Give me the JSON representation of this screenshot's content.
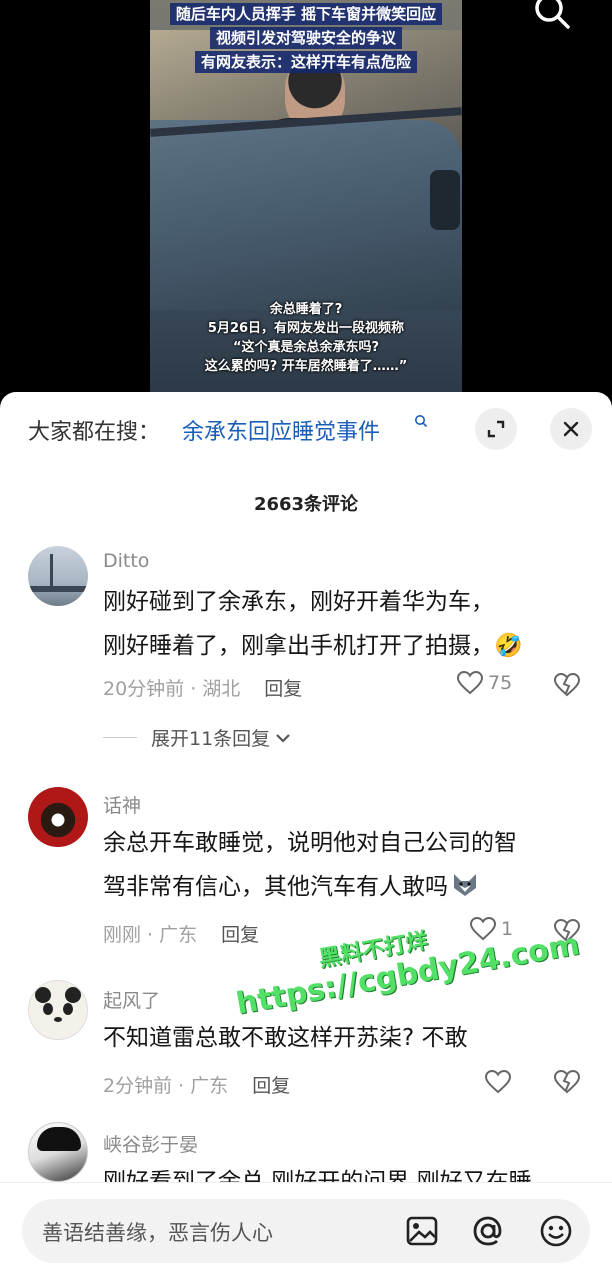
{
  "video": {
    "captions_top": [
      "随后车内人员挥手 摇下车窗并微笑回应",
      "视频引发对驾驶安全的争议",
      "有网友表示：这样开车有点危险"
    ],
    "captions_bottom": [
      "余总睡着了?",
      "5月26日，有网友发出一段视频称",
      "“这个真是余总余承东吗?",
      "这么累的吗? 开车居然睡着了……”"
    ]
  },
  "sheet": {
    "hot_prefix": "大家都在搜：",
    "hot_link": "余承东回应睡觉事件",
    "comment_count": "2663条评论"
  },
  "comments": [
    {
      "user": "Ditto",
      "text": [
        "刚好碰到了余承东，刚好开着华为车，",
        "刚好睡着了，刚拿出手机打开了拍摄，"
      ],
      "emoji": "🤣",
      "time": "20分钟前 · 湖北",
      "reply": "回复",
      "likes": "75",
      "expand": "展开11条回复"
    },
    {
      "user": "话神",
      "text": [
        "余总开车敢睡觉，说明他对自己公司的智",
        "驾非常有信心，其他汽车有人敢吗"
      ],
      "time": "刚刚 · 广东",
      "reply": "回复",
      "likes": "1"
    },
    {
      "user": "起风了",
      "text": [
        "不知道雷总敢不敢这样开苏柒? 不敢"
      ],
      "time": "2分钟前 · 广东",
      "reply": "回复",
      "likes": ""
    },
    {
      "user": "峡谷彭于晏",
      "text": [
        "刚好看到了余总 刚好开的问界 刚好又在睡"
      ]
    }
  ],
  "watermark": {
    "line1": "黑料不打烊",
    "line2": "https://cgbdy24.com"
  },
  "input": {
    "placeholder": "善语结善缘，恶言伤人心"
  },
  "colors": {
    "link": "#1a5eb8",
    "caption_bg": "#14286e",
    "watermark": "#52e066"
  },
  "icons": [
    "search-icon",
    "collapse-icon",
    "close-icon",
    "heart-icon",
    "broken-heart-icon",
    "chevron-down-icon",
    "image-icon",
    "at-icon",
    "emoji-icon"
  ]
}
